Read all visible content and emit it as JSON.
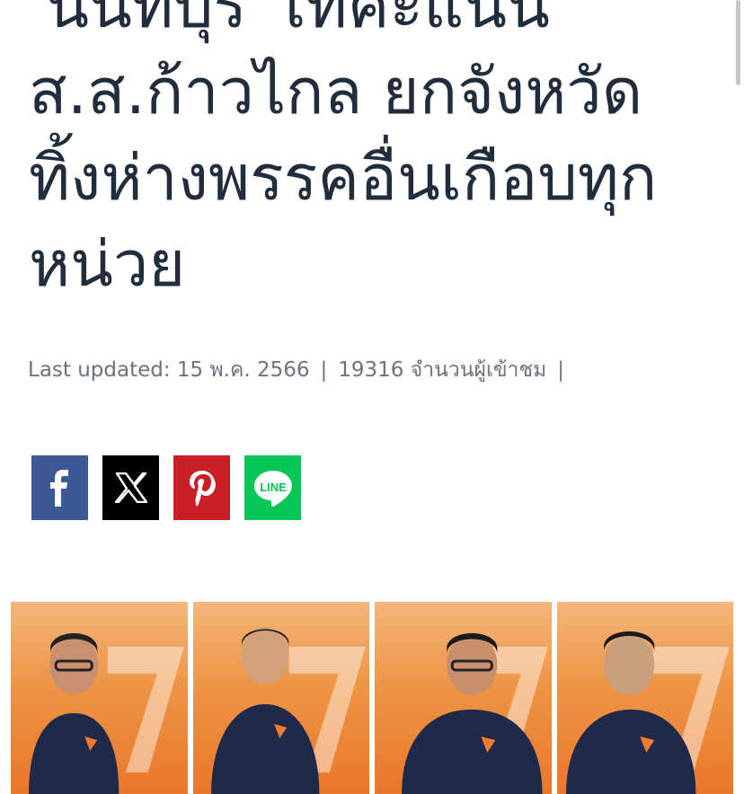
{
  "article": {
    "headline_lines": [
      "'นนทบุรี' เทคะแนน",
      "ส.ส.ก้าวไกล ยกจังหวัด",
      "ทิ้งห่างพรรคอื่นเกือบทุก",
      "หน่วย"
    ],
    "meta": {
      "updated": "Last updated: 15 พ.ค. 2566",
      "views": "19316 จำนวนผู้เข้าชม",
      "separator": "|"
    }
  },
  "share": {
    "buttons": [
      {
        "label": "f",
        "icon": "facebook-icon",
        "color": "#3b5998"
      },
      {
        "label": "X",
        "icon": "x-icon",
        "color": "#000000"
      },
      {
        "label": "P",
        "icon": "pinterest-icon",
        "color": "#cb1f27"
      },
      {
        "label": "LINE",
        "icon": "line-icon",
        "color": "#06c755"
      }
    ]
  },
  "photo": {
    "panels": 4,
    "accent": "#ee9444",
    "shirt": "#1f2a4a"
  }
}
